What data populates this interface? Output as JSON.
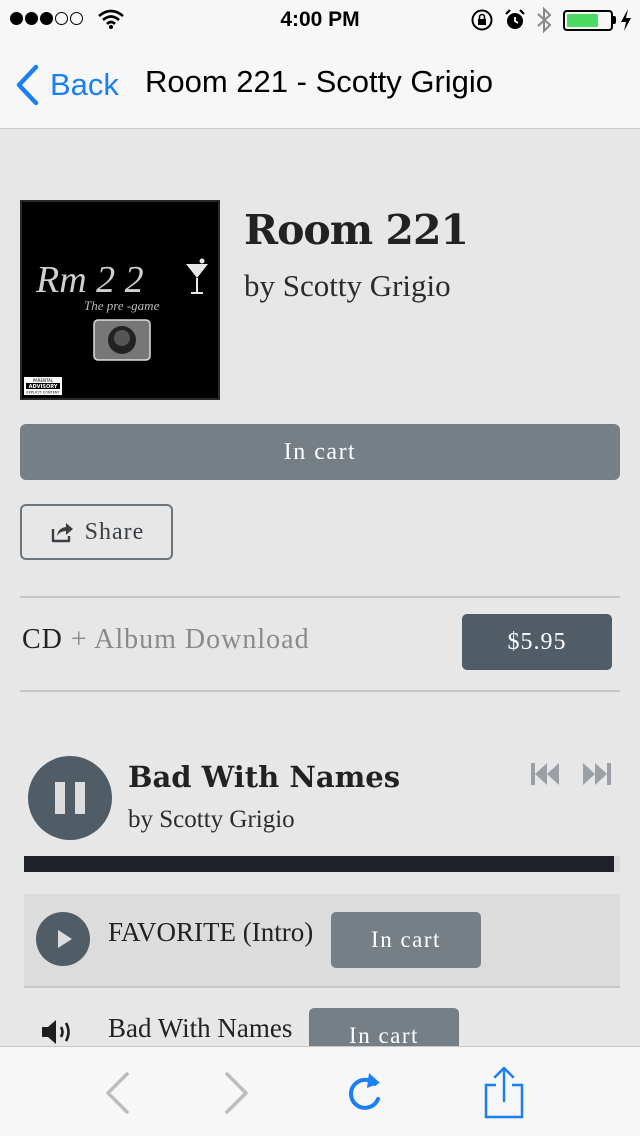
{
  "status_bar": {
    "time": "4:00 PM",
    "signal_dots_filled": 3,
    "signal_dots_total": 5,
    "battery_level": 0.7,
    "icons": [
      "wifi-icon",
      "rotation-lock-icon",
      "alarm-icon",
      "bluetooth-icon",
      "battery-icon",
      "charging-icon"
    ]
  },
  "nav": {
    "back_label": "Back",
    "title": "Room 221 - Scotty Grigio"
  },
  "album": {
    "art_text": "Rm 2 2",
    "art_subtext": "The pre -game",
    "advisory_line1": "PARENTAL",
    "advisory_line2": "ADVISORY",
    "advisory_line3": "EXPLICIT CONTENT",
    "title": "Room 221",
    "artist": "by Scotty Grigio",
    "in_cart_label": "In cart",
    "share_label": "Share"
  },
  "format": {
    "name": "CD",
    "extra": "+ Album Download",
    "price": "$5.95"
  },
  "player": {
    "track_title": "Bad With Names",
    "track_artist": "by Scotty Grigio",
    "progress": 0.99
  },
  "tracks": [
    {
      "title": "FAVORITE (Intro)",
      "button": "In cart",
      "state": "paused-selectable"
    },
    {
      "title": "Bad With Names",
      "button": "In cart",
      "state": "playing"
    }
  ],
  "colors": {
    "accent_blue": "#1a7ef5",
    "button_gray": "#757f85",
    "button_dark": "#505d66",
    "battery_green": "#4cd964"
  }
}
